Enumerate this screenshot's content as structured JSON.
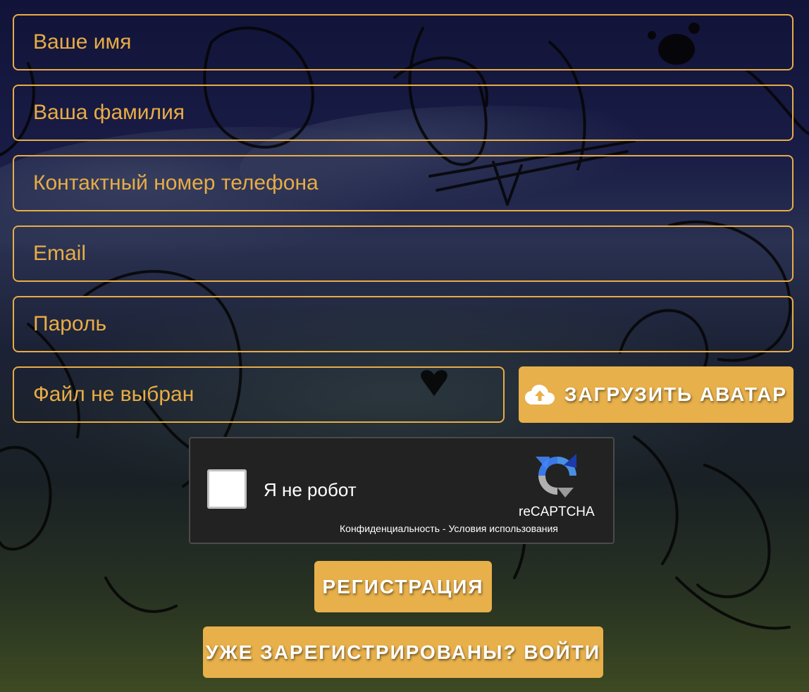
{
  "form": {
    "first_name": {
      "placeholder": "Ваше имя",
      "value": ""
    },
    "last_name": {
      "placeholder": "Ваша фамилия",
      "value": ""
    },
    "phone": {
      "placeholder": "Контактный номер телефона",
      "value": ""
    },
    "email": {
      "placeholder": "Email",
      "value": ""
    },
    "password": {
      "placeholder": "Пароль",
      "value": ""
    },
    "file_status": "Файл не выбран",
    "upload_avatar_label": "ЗАГРУЗИТЬ АВАТАР",
    "upload_icon": "cloud-upload-icon"
  },
  "captcha": {
    "label": "Я не робот",
    "brand": "reCAPTCHA",
    "privacy_link": "Конфиденциальность",
    "separator": " - ",
    "terms_link": "Условия использования",
    "logo_icon": "recaptcha-logo-icon"
  },
  "actions": {
    "register_label": "РЕГИСТРАЦИЯ",
    "login_label": "УЖЕ ЗАРЕГИСТРИРОВАНЫ? ВОЙТИ"
  },
  "colors": {
    "accent": "#e8ac45",
    "button": "#e8b04a",
    "captcha_bg": "#222222",
    "background": "#14163a"
  }
}
